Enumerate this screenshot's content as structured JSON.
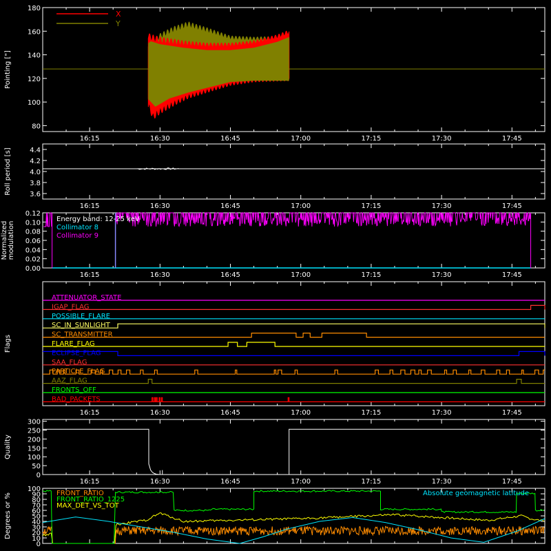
{
  "colors": {
    "background": "#000000",
    "axis": "#ffffff",
    "x_pointing": "#ff0000",
    "y_pointing": "#808000",
    "roll": "#ffffff",
    "collimator8": "#00e5ff",
    "collimator9": "#ff00ff",
    "quality": "#ffffff",
    "front_ratio": "#ff8c00",
    "front_ratio_1225": "#ffff00",
    "max_det_vs_tot": "#00ff00",
    "abs_geomag_lat": "#00e5ff"
  },
  "time_axis": {
    "tick_labels": [
      "16:15",
      "16:30",
      "16:45",
      "17:00",
      "17:15",
      "17:30",
      "17:45"
    ],
    "tick_minutes": [
      15,
      30,
      45,
      60,
      75,
      90,
      105
    ],
    "range_minutes": [
      5,
      112
    ]
  },
  "chart_data": [
    {
      "id": "pointing",
      "type": "line",
      "ylabel": "Pointing [\"]",
      "ylim": [
        75,
        180
      ],
      "yticks": [
        80,
        100,
        120,
        140,
        160,
        180
      ],
      "legend": [
        "X",
        "Y"
      ],
      "legend_position": "top-left",
      "reference_line": 128,
      "series": [
        {
          "name": "X",
          "color": "#ff0000",
          "t_start": 27.5,
          "t_end": 57.5,
          "min_points": [
            [
              27.6,
              95
            ],
            [
              28.5,
              85
            ],
            [
              30,
              90
            ],
            [
              33,
              97
            ],
            [
              36,
              103
            ],
            [
              40,
              108
            ],
            [
              45,
              114
            ],
            [
              50,
              117
            ],
            [
              57.5,
              118
            ]
          ],
          "max_points": [
            [
              27.6,
              158
            ],
            [
              30,
              155
            ],
            [
              35,
              152
            ],
            [
              40,
              150
            ],
            [
              45,
              150
            ],
            [
              50,
              152
            ],
            [
              55,
              157
            ],
            [
              57.5,
              161
            ]
          ]
        },
        {
          "name": "Y",
          "color": "#808000",
          "t_start": 27.5,
          "t_end": 57.5,
          "min_points": [
            [
              27.6,
              102
            ],
            [
              29,
              96
            ],
            [
              32,
              103
            ],
            [
              36,
              108
            ],
            [
              40,
              112
            ],
            [
              45,
              117
            ],
            [
              50,
              118
            ],
            [
              57.5,
              118
            ]
          ],
          "max_points": [
            [
              27.6,
              150
            ],
            [
              30,
              158
            ],
            [
              33,
              164
            ],
            [
              36,
              168
            ],
            [
              40,
              163
            ],
            [
              45,
              156
            ],
            [
              50,
              155
            ],
            [
              57.5,
              156
            ]
          ]
        }
      ]
    },
    {
      "id": "roll",
      "type": "line",
      "ylabel": "Roll period [s]",
      "ylim": [
        3.5,
        4.5
      ],
      "yticks": [
        3.6,
        3.8,
        4.0,
        4.2,
        4.4
      ],
      "series": [
        {
          "name": "",
          "color": "#ffffff",
          "x": [
            5,
            112
          ],
          "y": [
            4.05,
            4.05
          ]
        }
      ]
    },
    {
      "id": "modulation",
      "type": "line",
      "ylabel": "Normalized modulation",
      "ylim": [
        0,
        0.12
      ],
      "yticks": [
        0.0,
        0.02,
        0.04,
        0.06,
        0.08,
        0.1,
        0.12
      ],
      "annotations": [
        "Energy band: 12-25 keV",
        "Collimator 8",
        "Collimator 9"
      ],
      "legend_position": "top-left",
      "series": [
        {
          "name": "Collimator 8",
          "color": "#00e5ff",
          "t_range": [
            7,
            109
          ],
          "value": 0.0
        },
        {
          "name": "Collimator 9",
          "color": "#ff00ff",
          "t_range": [
            20.5,
            109
          ],
          "low": 0.09,
          "high": 0.12
        }
      ]
    },
    {
      "id": "flags",
      "type": "line",
      "ylabel": "Flags",
      "rows": [
        {
          "name": "ATTENUATOR_STATE",
          "color": "#ff00ff",
          "high": []
        },
        {
          "name": "IGAP_FLAG",
          "color": "#ff3030",
          "high": [
            [
              109,
              112
            ]
          ]
        },
        {
          "name": "POSSIBLE_FLARE",
          "color": "#00e5ff",
          "high": []
        },
        {
          "name": "SC_IN_SUNLIGHT",
          "color": "#ffff66",
          "high": [
            [
              21,
              112
            ]
          ]
        },
        {
          "name": "SC_TRANSMITTER",
          "color": "#ff8c00",
          "high": [
            [
              49.5,
              59
            ],
            [
              60.5,
              62
            ],
            [
              64.5,
              74
            ]
          ]
        },
        {
          "name": "FLARE_FLAG",
          "color": "#ffff00",
          "high": [
            [
              44.5,
              46.5
            ],
            [
              48.5,
              54.5
            ]
          ]
        },
        {
          "name": "ECLIPSE_FLAG",
          "color": "#0000ff",
          "high": [
            [
              5,
              21
            ],
            [
              106.5,
              112
            ]
          ]
        },
        {
          "name": "SAA_FLAG",
          "color": "#ff3030",
          "high": []
        },
        {
          "name": "PARTICLE_FLAG",
          "color": "#ff8c00",
          "spiky": true
        },
        {
          "name": "AAZ_FLAG",
          "color": "#808000",
          "high": [
            [
              27.5,
              28.3
            ],
            [
              106,
              107
            ]
          ]
        },
        {
          "name": "FRONTS_OFF",
          "color": "#00ff00",
          "high": []
        },
        {
          "name": "BAD_PACKETS",
          "color": "#ff0000",
          "spikes": [
            28.3,
            28.8,
            29.2,
            29.8,
            30.3,
            57.3
          ]
        }
      ]
    },
    {
      "id": "quality",
      "type": "line",
      "ylabel": "Quality",
      "ylim": [
        0,
        310
      ],
      "yticks": [
        0,
        50,
        100,
        150,
        200,
        250,
        300
      ],
      "series": [
        {
          "name": "",
          "color": "#ffffff",
          "x": [
            5,
            27.6,
            27.6,
            28.0,
            28.4,
            28.8,
            29.2,
            30,
            57.5,
            57.5,
            112
          ],
          "y": [
            255,
            255,
            60,
            25,
            12,
            6,
            2,
            0,
            0,
            255,
            255
          ]
        }
      ]
    },
    {
      "id": "degrees",
      "type": "line",
      "ylabel": "Degrees or %",
      "ylim": [
        0,
        100
      ],
      "yticks": [
        0,
        10,
        20,
        30,
        40,
        50,
        60,
        70,
        80,
        90,
        100
      ],
      "legend_position": "top-left",
      "series": [
        {
          "name": "FRONT_RATIO",
          "color": "#ff8c00",
          "baseline": 23,
          "noise": 8
        },
        {
          "name": "FRONT_RATIO_1225",
          "color": "#ffff00",
          "x": [
            5,
            27,
            30,
            35,
            60,
            80,
            100,
            105,
            107,
            109,
            112
          ],
          "y": [
            15,
            42,
            55,
            40,
            45,
            52,
            42,
            48,
            50,
            45,
            40
          ]
        },
        {
          "name": "MAX_DET_VS_TOT",
          "color": "#00ff00",
          "segments": [
            [
              5,
              7,
              95
            ],
            [
              7,
              20.5,
              0
            ],
            [
              20.5,
              33,
              93
            ],
            [
              33,
              41,
              60
            ],
            [
              41,
              50,
              62
            ],
            [
              50,
              77,
              95
            ],
            [
              77,
              90,
              62
            ],
            [
              90,
              106,
              57
            ],
            [
              106,
              110,
              91
            ],
            [
              110,
              112,
              60
            ]
          ]
        },
        {
          "name": "Absolute geomagnetic latitude",
          "color": "#00e5ff",
          "x": [
            5,
            12,
            19,
            26,
            33,
            40,
            47,
            52,
            57,
            64,
            71,
            78,
            85,
            92,
            99,
            106,
            112
          ],
          "y": [
            38,
            48,
            40,
            30,
            20,
            8,
            0,
            12,
            26,
            40,
            47,
            38,
            25,
            10,
            2,
            22,
            45
          ]
        }
      ]
    }
  ]
}
